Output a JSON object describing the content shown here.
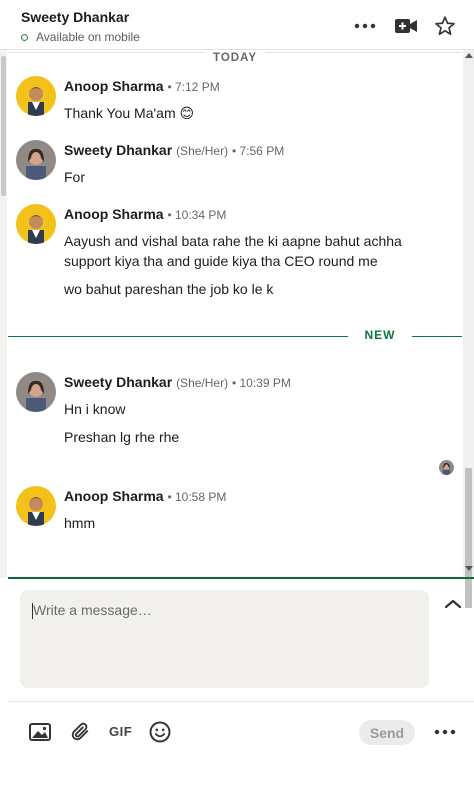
{
  "header": {
    "name": "Sweety Dhankar",
    "status": "Available on mobile",
    "icons": [
      "more-icon",
      "video-icon",
      "star-icon"
    ]
  },
  "dividers": {
    "today": "TODAY",
    "new": "NEW"
  },
  "messages": [
    {
      "sender": "Anoop Sharma",
      "pronouns": "",
      "time": "• 7:12 PM",
      "lines": [
        "Thank You Ma'am 😊"
      ]
    },
    {
      "sender": "Sweety Dhankar",
      "pronouns": "(She/Her)",
      "time": "• 7:56 PM",
      "lines": [
        "For"
      ]
    },
    {
      "sender": "Anoop Sharma",
      "pronouns": "",
      "time": "• 10:34 PM",
      "lines": [
        "Aayush and vishal bata rahe the ki aapne bahut achha",
        "support  kiya tha and guide kiya tha CEO round me",
        "wo bahut pareshan the job ko le k"
      ]
    },
    {
      "sender": "Sweety Dhankar",
      "pronouns": "(She/Her)",
      "time": "• 10:39 PM",
      "lines": [
        "Hn i know",
        "Preshan lg rhe rhe"
      ]
    },
    {
      "sender": "Anoop Sharma",
      "pronouns": "",
      "time": "• 10:58 PM",
      "lines": [
        "hmm"
      ]
    }
  ],
  "compose": {
    "placeholder": "Write a message…",
    "send_label": "Send",
    "gif_label": "GIF"
  },
  "colors": {
    "accent": "#0a7a3d",
    "compose_bg": "#f1f0ec"
  }
}
